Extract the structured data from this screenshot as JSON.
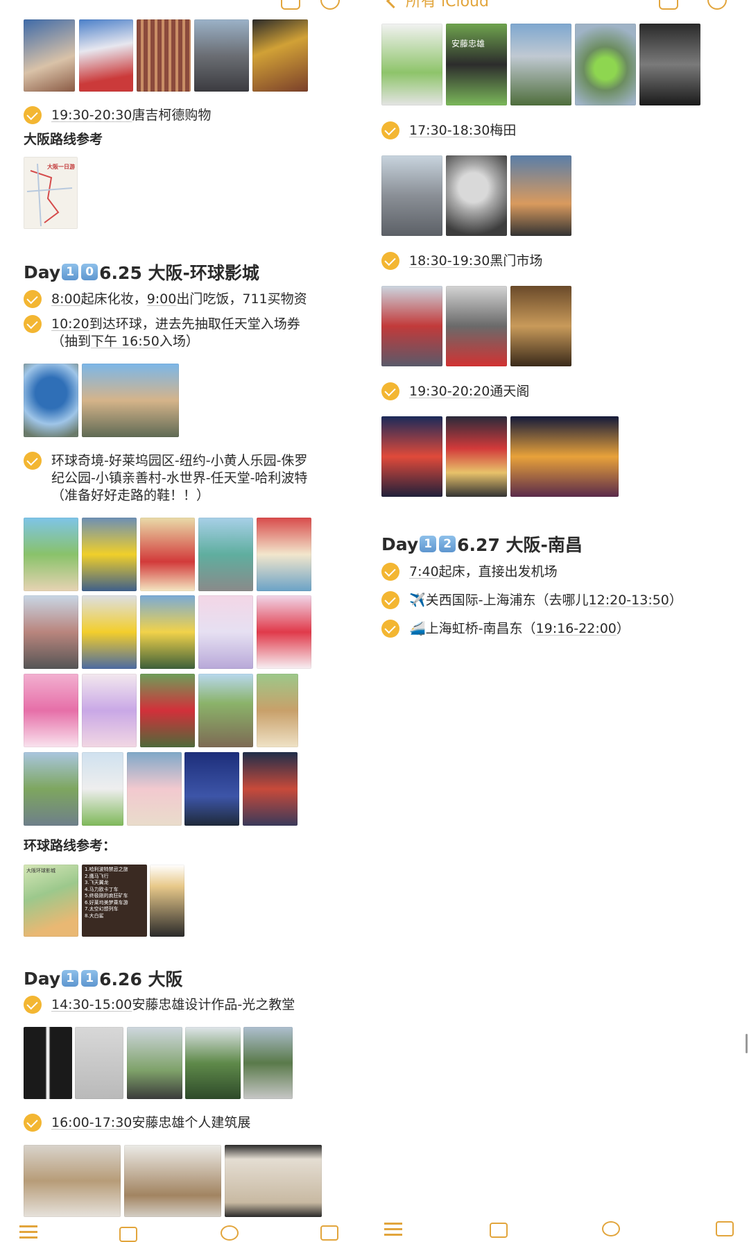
{
  "colors": {
    "accent": "#f3b632",
    "nav": "#e2a53c",
    "keycap": "#6aa3d9"
  },
  "left": {
    "item_1930": {
      "time": "19:30-20:30",
      "text": "唐吉柯德购物"
    },
    "osaka_route_label": "大阪路线参考",
    "map_caption": "大阪一日游",
    "day10": {
      "prefix": "Day",
      "keys": [
        "1",
        "0"
      ],
      "suffix": "6.25 大阪-环球影城"
    },
    "d10_items": [
      {
        "t1": "8:00",
        "m": "起床化妆，",
        "t2": "9:00",
        "e": "出门吃饭，711买物资"
      },
      {
        "t1": "10:20",
        "m": "到达环球，进去先抽取任天堂入场券",
        "line2a": "（抽到",
        "t2": "下午 16:50",
        "line2b": "入场）"
      }
    ],
    "d10_areas": {
      "line1": "环球奇境-好莱坞园区-纽约-小黄人乐园-侏罗",
      "line2": "纪公园-小镇亲善村-水世界-任天堂-哈利波特",
      "line3": "（准备好好走路的鞋！！）"
    },
    "usj_route_label": "环球路线参考：",
    "usj_route_card": [
      "1.哈利波特禁忌之旅",
      "2.鹰马飞行",
      "3.飞天翼龙",
      "4.马力欧卡丁车",
      "5.终极刚的疯狂矿车",
      "6.好莱坞美梦乘车游",
      "7.太空幻想列车",
      "8.大白鲨"
    ],
    "usj_map_caption": "大阪环球影城",
    "day11": {
      "prefix": "Day",
      "keys": [
        "1",
        "1"
      ],
      "suffix": "6.26 大阪"
    },
    "d11_items": [
      {
        "time": "14:30-15:00",
        "text": "安藤忠雄设计作品-光之教堂"
      },
      {
        "time": "16:00-17:30",
        "text": "安藤忠雄个人建筑展"
      }
    ]
  },
  "right": {
    "nav_back": "所有 iCloud",
    "items": [
      {
        "time": "17:30-18:30",
        "text": "梅田"
      },
      {
        "time": "18:30-19:30",
        "text": "黑门市场"
      },
      {
        "time": "19:30-20:20",
        "text": "通天阁"
      }
    ],
    "exhibit_text": "安藤忠雄",
    "day12": {
      "prefix": "Day",
      "keys": [
        "1",
        "2"
      ],
      "suffix": "6.27 大阪-南昌"
    },
    "d12_items": [
      {
        "t1": "7:40",
        "text": "起床，直接出发机场"
      },
      {
        "icon": "✈️",
        "text": "关西国际-上海浦东（去哪儿",
        "t": "12:20-13:50",
        "end": "）"
      },
      {
        "icon": "🚄",
        "text": "上海虹桥-南昌东（",
        "t": "19:16-22:00",
        "end": "）"
      }
    ]
  }
}
